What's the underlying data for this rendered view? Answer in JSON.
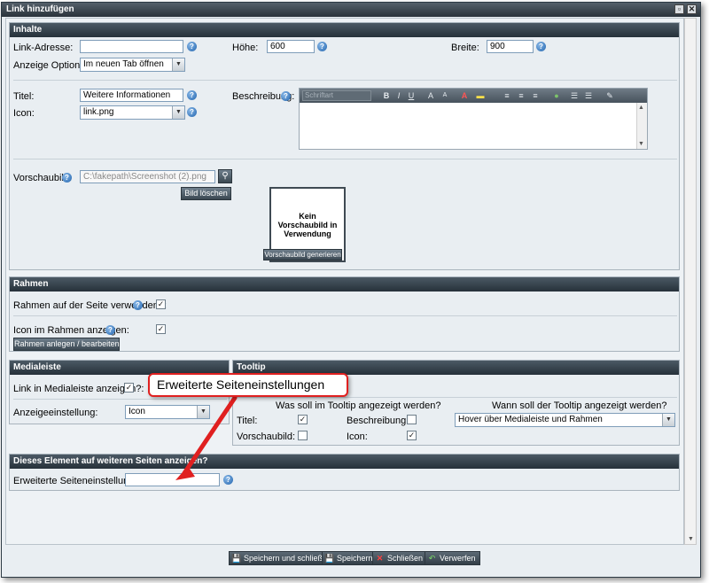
{
  "window": {
    "title": "Link hinzufügen",
    "minimize_icon": "restore-icon",
    "close_icon": "close-icon"
  },
  "inhalte": {
    "header": "Inhalte",
    "link_address_label": "Link-Adresse:",
    "link_address_value": "",
    "hoehe_label": "Höhe:",
    "hoehe_value": "600",
    "breite_label": "Breite:",
    "breite_value": "900",
    "anzeige_label": "Anzeige Optionen:",
    "anzeige_value": "Im neuen Tab öffnen",
    "titel_label": "Titel:",
    "titel_value": "Weitere Informationen",
    "icon_label": "Icon:",
    "icon_value": "link.png",
    "beschreibung_label": "Beschreibung:",
    "editor_font": "Schriftart",
    "vorschaubild_label": "Vorschaubild:",
    "vorschaubild_value": "C:\\fakepath\\Screenshot (2).png",
    "bild_loeschen": "Bild löschen",
    "preview_text": "Kein Vorschaubild in Verwendung",
    "vorschau_generieren": "Vorschaubild generieren"
  },
  "rahmen": {
    "header": "Rahmen",
    "use_label": "Rahmen auf der Seite verwenden?:",
    "icon_label": "Icon im Rahmen anzeigen:",
    "button": "Rahmen anlegen / bearbeiten"
  },
  "medialeiste": {
    "header": "Medialeiste",
    "show_label": "Link in Medialeiste anzeigen?:",
    "anzeige_label": "Anzeigeeinstellung:",
    "anzeige_value": "Icon"
  },
  "tooltip": {
    "header": "Tooltip",
    "question1": "Was soll im Tooltip angezeigt werden?",
    "question2": "Wann soll der Tooltip angezeigt werden?",
    "titel": "Titel:",
    "beschreibung": "Beschreibung:",
    "vorschaubild": "Vorschaubild:",
    "icon": "Icon:",
    "when_value": "Hover über Medialeiste und Rahmen"
  },
  "weitere": {
    "header": "Dieses Element auf weiteren Seiten anzeigen?",
    "label": "Erweiterte Seiteneinstellungen:",
    "value": ""
  },
  "callout": {
    "text": "Erweiterte Seiteneinstellungen",
    "color": "#e02020"
  },
  "footer": {
    "save_close": "Speichern und schließen",
    "save": "Speichern",
    "close": "Schließen",
    "discard": "Verwerfen"
  }
}
